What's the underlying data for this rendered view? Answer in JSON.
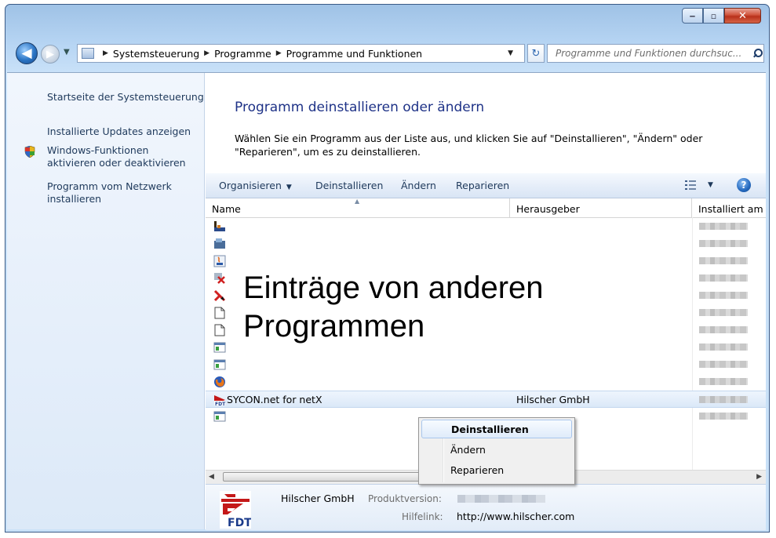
{
  "window": {
    "caption": {
      "minimize": "‒",
      "maximize": "▫",
      "close": "✕"
    }
  },
  "nav": {
    "back": "◀",
    "forward": "▶",
    "breadcrumbs": [
      "Systemsteuerung",
      "Programme",
      "Programme und Funktionen"
    ],
    "search_placeholder": "Programme und Funktionen durchsuc..."
  },
  "sidebar": {
    "items": [
      {
        "label": "Startseite der Systemsteuerung"
      },
      {
        "label": "Installierte Updates anzeigen"
      },
      {
        "label": "Windows-Funktionen aktivieren oder deaktivieren"
      },
      {
        "label": "Programm vom Netzwerk installieren"
      }
    ]
  },
  "main": {
    "title": "Programm deinstallieren oder ändern",
    "instructions": "Wählen Sie ein Programm aus der Liste aus, und klicken Sie auf \"Deinstallieren\", \"Ändern\" oder \"Reparieren\", um es zu deinstallieren."
  },
  "toolbar": {
    "organize": "Organisieren",
    "uninstall": "Deinstallieren",
    "change": "Ändern",
    "repair": "Reparieren",
    "help": "?"
  },
  "list": {
    "columns": [
      "Name",
      "Herausgeber",
      "Installiert am"
    ],
    "overlay": [
      "Einträge von anderen",
      "Programmen"
    ],
    "selected": {
      "name": "SYCON.net for netX",
      "publisher": "Hilscher GmbH"
    }
  },
  "details": {
    "publisher": "Hilscher GmbH",
    "version_label": "Produktversion:",
    "help_label": "Hilfelink:",
    "help_link": "http://www.hilscher.com",
    "logo_text": "FDT"
  },
  "context_menu": {
    "items": [
      "Deinstallieren",
      "Ändern",
      "Reparieren"
    ],
    "default": "Deinstallieren"
  },
  "colors": {
    "accent": "#1e3287",
    "link": "#1e395b",
    "selection": "#dbe8f8"
  }
}
